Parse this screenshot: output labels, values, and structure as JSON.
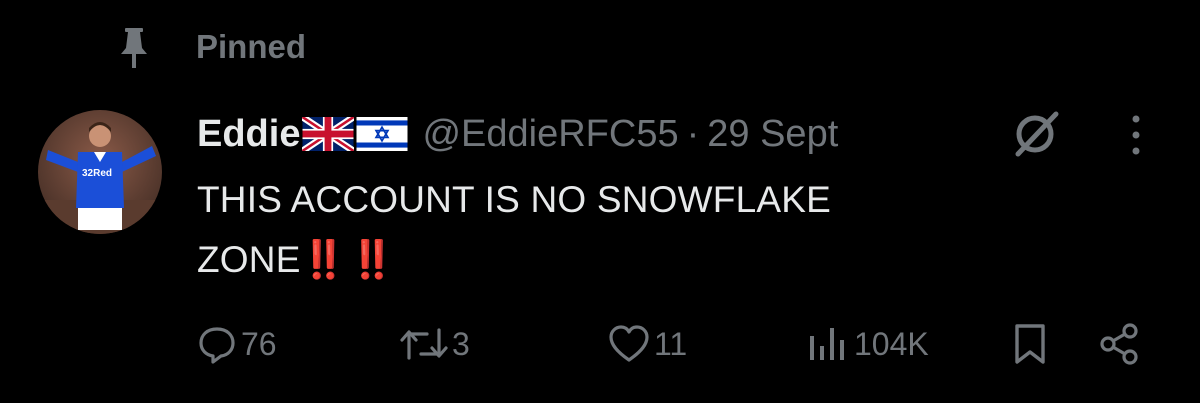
{
  "pinned": {
    "label": "Pinned",
    "icon": "pin-icon"
  },
  "tweet": {
    "author": {
      "display_name": "Eddie",
      "flags": [
        "uk-flag-icon",
        "israel-flag-icon"
      ],
      "handle": "@EddieRFC55",
      "separator": "·",
      "time": "29 Sept"
    },
    "text_line1": "THIS ACCOUNT IS NO SNOWFLAKE",
    "text_line2": "ZONE",
    "emphasis": "‼️ ‼️",
    "actions": {
      "replies": "76",
      "reposts": "3",
      "likes": "11",
      "views": "104K"
    }
  },
  "colors": {
    "background": "#000000",
    "primary_text": "#e7e9ea",
    "secondary_text": "#71767b",
    "emphasis": "#e0245e",
    "avatar_jersey": "#1b4fd8"
  }
}
